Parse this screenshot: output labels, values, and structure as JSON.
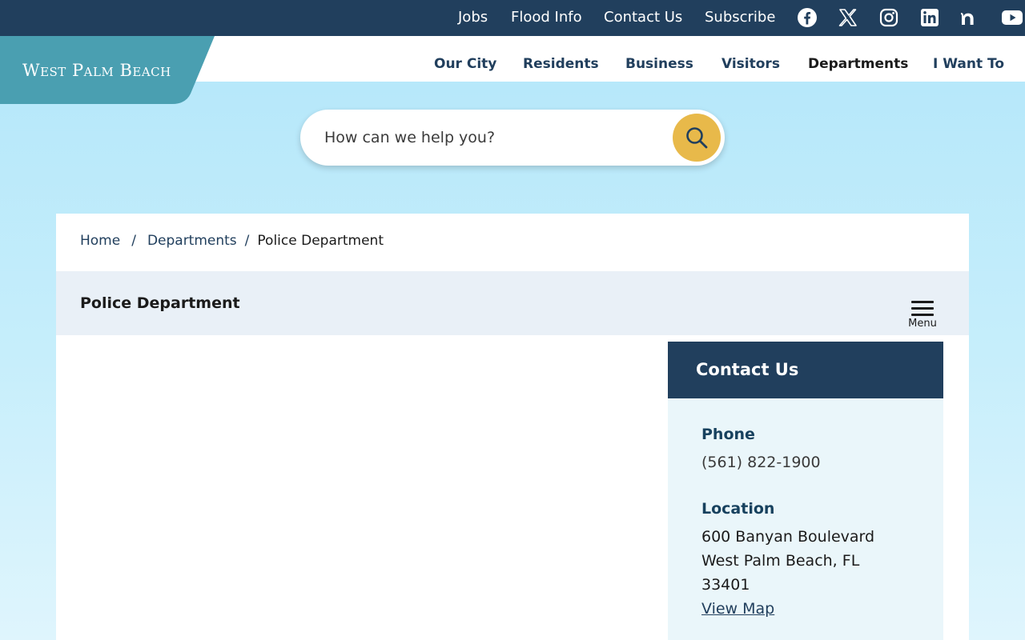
{
  "topbar": {
    "links": [
      "Jobs",
      "Flood Info",
      "Contact Us",
      "Subscribe"
    ],
    "social": [
      "facebook-icon",
      "x-twitter-icon",
      "instagram-icon",
      "linkedin-icon",
      "nextdoor-icon",
      "youtube-icon"
    ]
  },
  "logo": {
    "text": "West Palm Beach"
  },
  "nav": {
    "items": [
      "Our City",
      "Residents",
      "Business",
      "Visitors",
      "Departments",
      "I Want To"
    ]
  },
  "search": {
    "placeholder": "How can we help you?",
    "icon": "search-icon"
  },
  "breadcrumb": {
    "home": "Home",
    "separator": "/",
    "departments": "Departments",
    "current": "Police Department"
  },
  "page": {
    "title": "Police Department",
    "menu_label": "Menu"
  },
  "contact": {
    "title": "Contact Us",
    "phone_label": "Phone",
    "phone": "(561) 822-1900",
    "location_label": "Location",
    "address_line1": "600 Banyan Boulevard",
    "address_line2": "West Palm Beach, FL",
    "address_line3": "33401",
    "map_link": "View Map"
  },
  "colors": {
    "navy": "#213f5d",
    "teal_logo": "#4a9fb1",
    "search_button": "#e8b94a",
    "sky": "#b2e6fa"
  }
}
